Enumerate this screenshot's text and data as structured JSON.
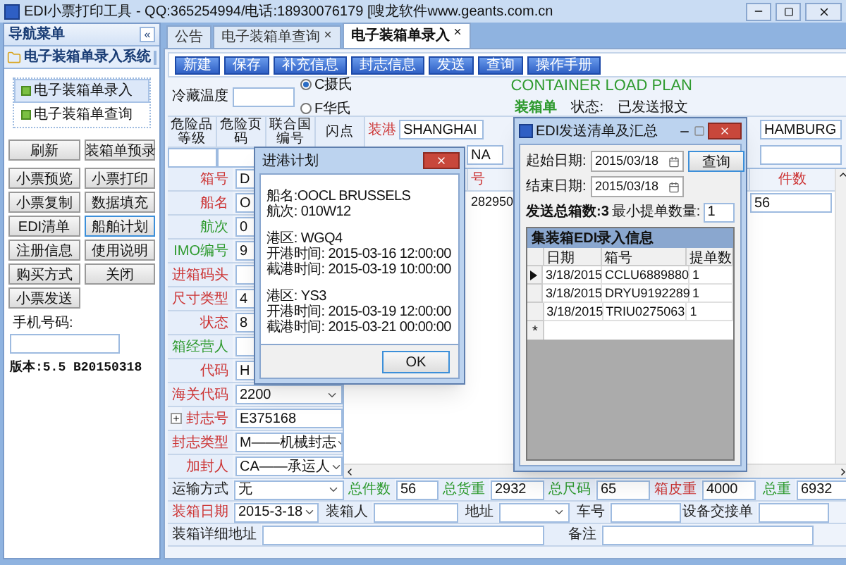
{
  "window": {
    "title": "EDI小票打印工具 - QQ:365254994/电话:18930076179 [嗖龙软件www.geants.com.cn"
  },
  "sidebar": {
    "title": "导航菜单",
    "collapse": "«",
    "section": "电子装箱单录入系统",
    "items": [
      {
        "label": "电子装箱单录入",
        "selected": true
      },
      {
        "label": "电子装箱单查询",
        "selected": false
      }
    ],
    "buttons": [
      {
        "label": "刷新",
        "focused": false
      },
      {
        "label": "装箱单预录",
        "focused": false
      },
      {
        "label": "小票预览",
        "focused": false
      },
      {
        "label": "小票打印",
        "focused": false
      },
      {
        "label": "小票复制",
        "focused": false
      },
      {
        "label": "数据填充",
        "focused": false
      },
      {
        "label": "EDI清单",
        "focused": false
      },
      {
        "label": "船舶计划",
        "focused": true
      },
      {
        "label": "注册信息",
        "focused": false
      },
      {
        "label": "使用说明",
        "focused": false
      },
      {
        "label": "购买方式",
        "focused": false
      },
      {
        "label": "关闭",
        "focused": false
      },
      {
        "label": "小票发送",
        "focused": false
      }
    ],
    "phone_label": "手机号码:",
    "version": "版本:5.5 B20150318"
  },
  "tabs": [
    {
      "label": "公告",
      "closable": false,
      "selected": false
    },
    {
      "label": "电子装箱单查询",
      "closable": true,
      "selected": false
    },
    {
      "label": "电子装箱单录入",
      "closable": true,
      "selected": true
    }
  ],
  "toolbar": [
    "新建",
    "保存",
    "补充信息",
    "封志信息",
    "发送",
    "查询",
    "操作手册"
  ],
  "header": {
    "temp_label": "冷藏温度",
    "units": [
      {
        "label": "C摄氏",
        "selected": true
      },
      {
        "label": "F华氏",
        "selected": false
      }
    ],
    "plan_title": "CONTAINER LOAD PLAN",
    "doc_type": "装箱单",
    "status_label": "状态:",
    "status": "已发送报文"
  },
  "hazard_columns": [
    "危险品等级",
    "危险页码",
    "联合国编号",
    "闪点"
  ],
  "ports": {
    "load_label": "装港",
    "load": "SHANGHAI",
    "load_2": "NA",
    "discharge": "HAMBURG"
  },
  "form": [
    {
      "label": "箱号",
      "color": "#cc3333",
      "kind": "text",
      "value": "D"
    },
    {
      "label": "船名",
      "color": "#cc3333",
      "kind": "text",
      "value": "O"
    },
    {
      "label": "航次",
      "color": "#2e9a2e",
      "kind": "text",
      "value": "0"
    },
    {
      "label": "IMO编号",
      "color": "#2e9a2e",
      "kind": "text",
      "value": "9"
    },
    {
      "label": "进箱码头",
      "color": "#cc3333",
      "kind": "text"
    },
    {
      "label": "尺寸类型",
      "color": "#cc3333",
      "kind": "text",
      "value": "4"
    },
    {
      "label": "状态",
      "color": "#cc3333",
      "kind": "text",
      "value": "8"
    },
    {
      "label": "箱经营人",
      "color": "#2e9a2e",
      "kind": "text"
    },
    {
      "label": "代码",
      "color": "#cc3333",
      "kind": "text",
      "value": "H"
    },
    {
      "label": "海关代码",
      "color": "#cc3333",
      "kind": "select",
      "value": "2200"
    },
    {
      "label": "封志号",
      "color": "#cc3333",
      "kind": "expandable",
      "value": "E375168"
    },
    {
      "label": "封志类型",
      "color": "#cc3333",
      "kind": "select",
      "value": "M——机械封志"
    },
    {
      "label": "加封人",
      "color": "#cc3333",
      "kind": "select",
      "value": "CA——承运人"
    }
  ],
  "grid": {
    "columns": [
      "号",
      "件数"
    ],
    "rows": [
      [
        "282950",
        "56"
      ]
    ]
  },
  "bottom_rows": [
    [
      {
        "label": "运输方式",
        "color": "#222222",
        "kind": "select",
        "value": "无"
      },
      {
        "label": "总件数",
        "color": "#2e9a2e",
        "kind": "text",
        "value": "56"
      },
      {
        "label": "总货重",
        "color": "#2e9a2e",
        "kind": "text",
        "value": "2932"
      },
      {
        "label": "总尺码",
        "color": "#2e9a2e",
        "kind": "text",
        "value": "65"
      },
      {
        "label": "箱皮重",
        "color": "#cc3333",
        "kind": "text",
        "value": "4000"
      },
      {
        "label": "总重",
        "color": "#2e9a2e",
        "kind": "text",
        "value": "6932"
      }
    ],
    [
      {
        "label": "装箱日期",
        "color": "#cc3333",
        "kind": "select",
        "value": "2015-3-18"
      },
      {
        "label": "装箱人",
        "color": "#222222",
        "kind": "text"
      },
      {
        "label": "地址",
        "color": "#222222",
        "kind": "select"
      },
      {
        "label": "车号",
        "color": "#222222",
        "kind": "text"
      },
      {
        "label": "设备交接单",
        "color": "#222222",
        "kind": "text"
      }
    ],
    [
      {
        "label": "装箱详细地址",
        "color": "#222222",
        "kind": "text"
      },
      {
        "label": "备注",
        "color": "#222222",
        "kind": "text"
      }
    ]
  ],
  "port_plan_dialog": {
    "title": "进港计划",
    "groups": [
      [
        "船名:OOCL BRUSSELS",
        "航次: 010W12"
      ],
      [
        "港区: WGQ4",
        "开港时间: 2015-03-16 12:00:00",
        "截港时间: 2015-03-19 10:00:00"
      ],
      [
        "港区: YS3",
        "开港时间: 2015-03-19 12:00:00",
        "截港时间: 2015-03-21 00:00:00"
      ]
    ],
    "ok": "OK"
  },
  "edi_dialog": {
    "title": "EDI发送清单及汇总",
    "start_label": "起始日期:",
    "start": "2015/03/18",
    "end_label": "结束日期:",
    "end": "2015/03/18",
    "query": "查询",
    "min_label": "最小提单数量:",
    "min_value": "1",
    "total": "发送总箱数:3",
    "grid_title": "集装箱EDI录入信息",
    "columns": [
      "日期",
      "箱号",
      "提单数"
    ],
    "rows": [
      {
        "cells": [
          "3/18/2015",
          "CCLU6889880",
          "1"
        ],
        "selected": true
      },
      {
        "cells": [
          "3/18/2015",
          "DRYU9192289",
          "1"
        ],
        "selected": false
      },
      {
        "cells": [
          "3/18/2015",
          "TRIU0275063",
          "1"
        ],
        "selected": false
      }
    ],
    "new_row_marker": "*"
  }
}
